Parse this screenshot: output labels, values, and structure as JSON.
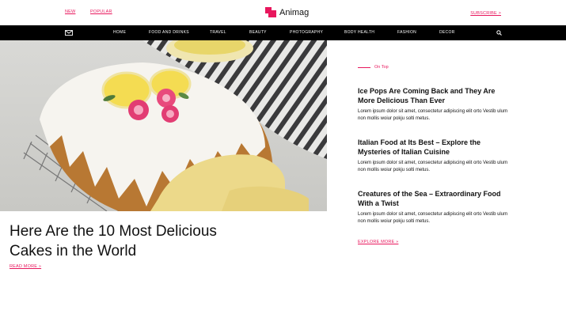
{
  "topbar": {
    "new_label": "NEW",
    "popular_label": "POPULAR",
    "brand_name": "Animag",
    "subscribe_label": "SUBSCRIBE >"
  },
  "nav": {
    "mail_icon": "mail-icon",
    "items": [
      "HOME",
      "FOOD AND DRINKS",
      "TRAVEL",
      "BEAUTY",
      "PHOTOGRAPHY",
      "BODY HEALTH",
      "FASHION",
      "DECOR"
    ],
    "search_icon": "search-icon"
  },
  "hero": {
    "title": "Here Are the 10 Most Delicious Cakes in the World",
    "read_more": "READ MORE »"
  },
  "sidebar": {
    "section_label": "On Top",
    "posts": [
      {
        "title": "Ice Pops Are Coming Back and They Are More Delicious Than Ever",
        "excerpt": "Lorem ipsum dolor sit amet, consectetur adipiscing elit orto Vestib ulum non mollis woiur pokju solti metus."
      },
      {
        "title": "Italian Food at Its Best – Explore the Mysteries of Italian Cuisine",
        "excerpt": "Lorem ipsum dolor sit amet, consectetur adipiscing elit orto Vestib ulum non mollis woiur pokju solti metus."
      },
      {
        "title": "Creatures of the Sea – Extraordinary Food With a Twist",
        "excerpt": "Lorem ipsum dolor sit amet, consectetur adipiscing elit orto Vestib ulum non mollis woiur pokju solti metus."
      }
    ],
    "explore_more": "EXPLORE MORE »"
  },
  "colors": {
    "accent": "#e8175d",
    "nav_background": "#000000",
    "page_background": "#ffffff"
  }
}
